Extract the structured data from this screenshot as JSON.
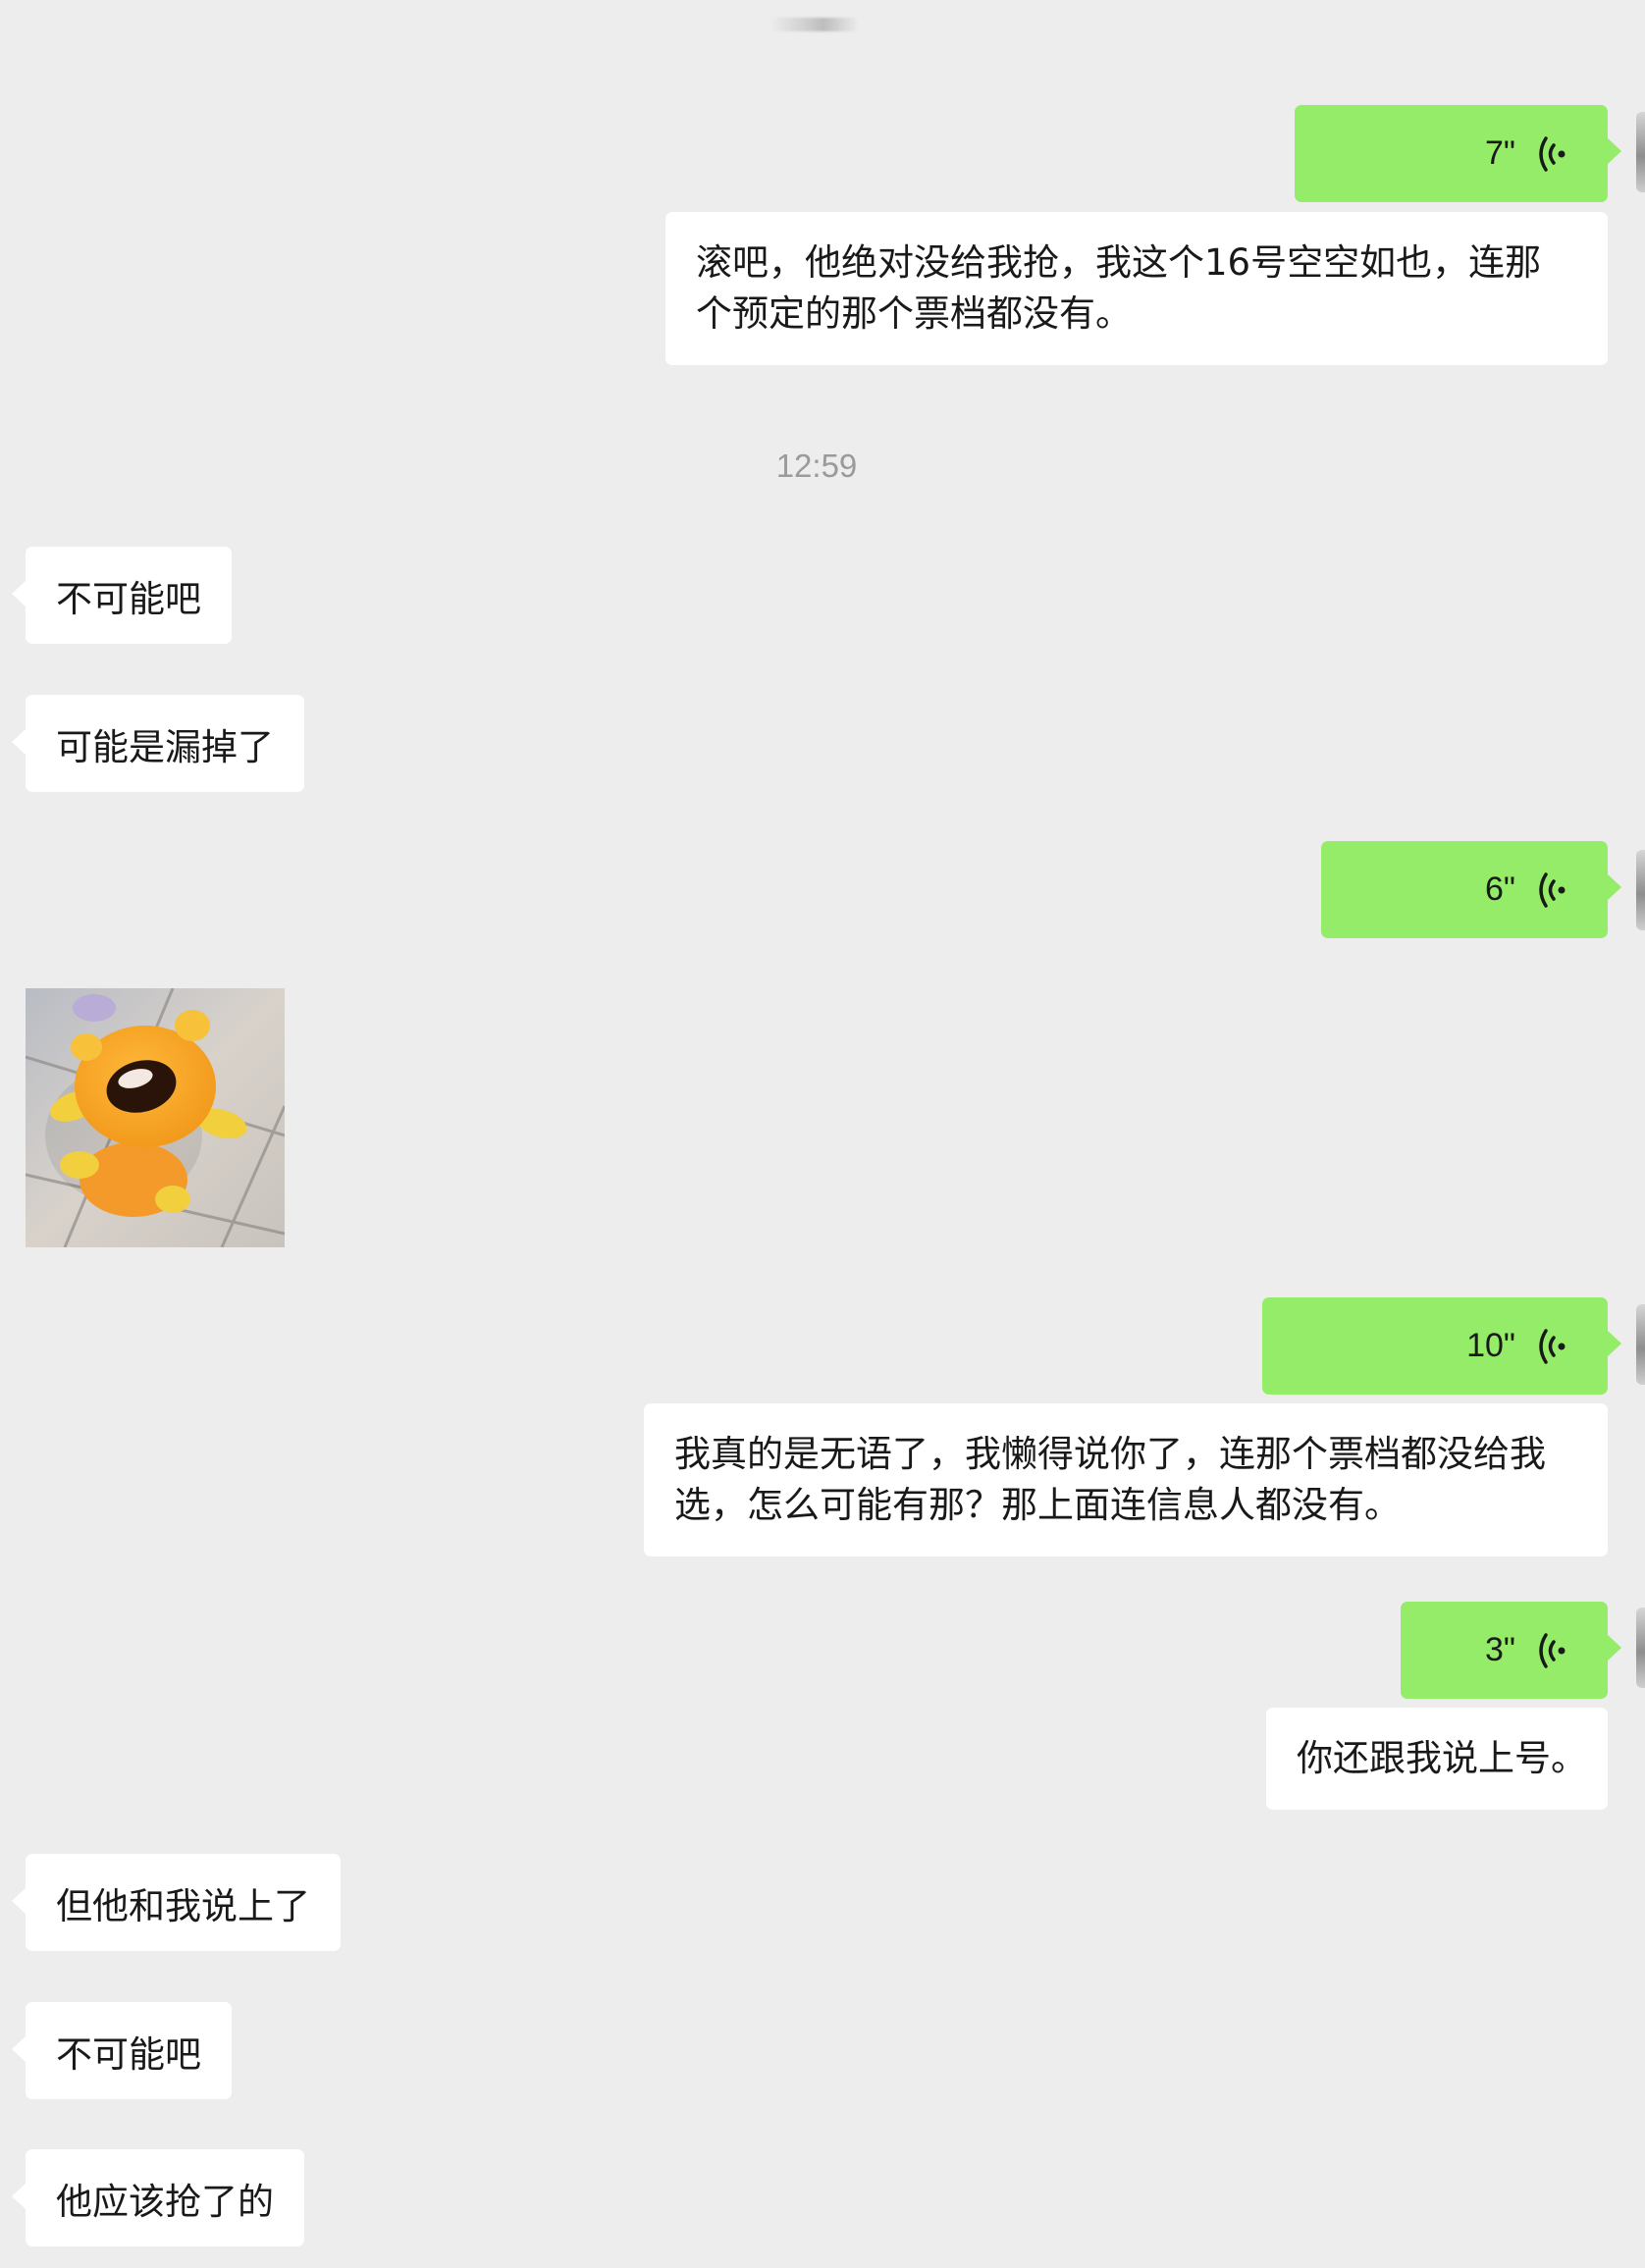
{
  "timestamp": "12:59",
  "messages": {
    "m1": {
      "duration": "7\"",
      "text": "滚吧，他绝对没给我抢，我这个16号空空如也，连那个预定的那个票档都没有。"
    },
    "m2": {
      "text": "不可能吧"
    },
    "m3": {
      "text": "可能是漏掉了"
    },
    "m4": {
      "duration": "6\""
    },
    "m5": {
      "sticker": "crying-yellow-creature-sticker"
    },
    "m6": {
      "duration": "10\"",
      "text": "我真的是无语了，我懒得说你了，连那个票档都没给我选，怎么可能有那？那上面连信息人都没有。"
    },
    "m7": {
      "duration": "3\"",
      "text": "你还跟我说上号。"
    },
    "m8": {
      "text": "但他和我说上了"
    },
    "m9": {
      "text": "不可能吧"
    },
    "m10": {
      "text": "他应该抢了的"
    }
  },
  "icons": {
    "voice_icon": "voice-wave-icon"
  },
  "colors": {
    "background": "#ededed",
    "outgoing_bubble": "#95ec69",
    "incoming_bubble": "#ffffff",
    "timestamp_text": "#9a9a9a"
  }
}
